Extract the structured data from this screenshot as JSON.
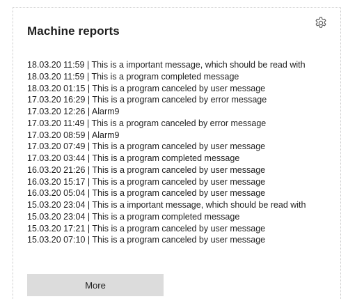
{
  "widget": {
    "title": "Machine reports",
    "settings_icon": "gear-icon",
    "more_label": "More"
  },
  "reports": [
    {
      "text": "18.03.20 11:59 | This is a important message, which should be read with"
    },
    {
      "text": "18.03.20 11:59 | This is a program completed message"
    },
    {
      "text": "18.03.20 01:15 | This is a program canceled by user message"
    },
    {
      "text": "17.03.20 16:29 | This is a program canceled by error message"
    },
    {
      "text": "17.03.20 12:26 | Alarm9"
    },
    {
      "text": "17.03.20 11:49 | This is a program canceled by error message"
    },
    {
      "text": "17.03.20 08:59 | Alarm9"
    },
    {
      "text": "17.03.20 07:49 | This is a program canceled by user message"
    },
    {
      "text": "17.03.20 03:44 | This is a program completed message"
    },
    {
      "text": "16.03.20 21:26 | This is a program canceled by user message"
    },
    {
      "text": "16.03.20 15:17 | This is a program canceled by user message"
    },
    {
      "text": "16.03.20 05:04 | This is a program canceled by user message"
    },
    {
      "text": "15.03.20 23:04 | This is a important message, which should be read with"
    },
    {
      "text": "15.03.20 23:04 | This is a program completed message"
    },
    {
      "text": "15.03.20 17:21 | This is a program canceled by user message"
    },
    {
      "text": "15.03.20 07:10 | This is a program canceled by user message"
    }
  ]
}
